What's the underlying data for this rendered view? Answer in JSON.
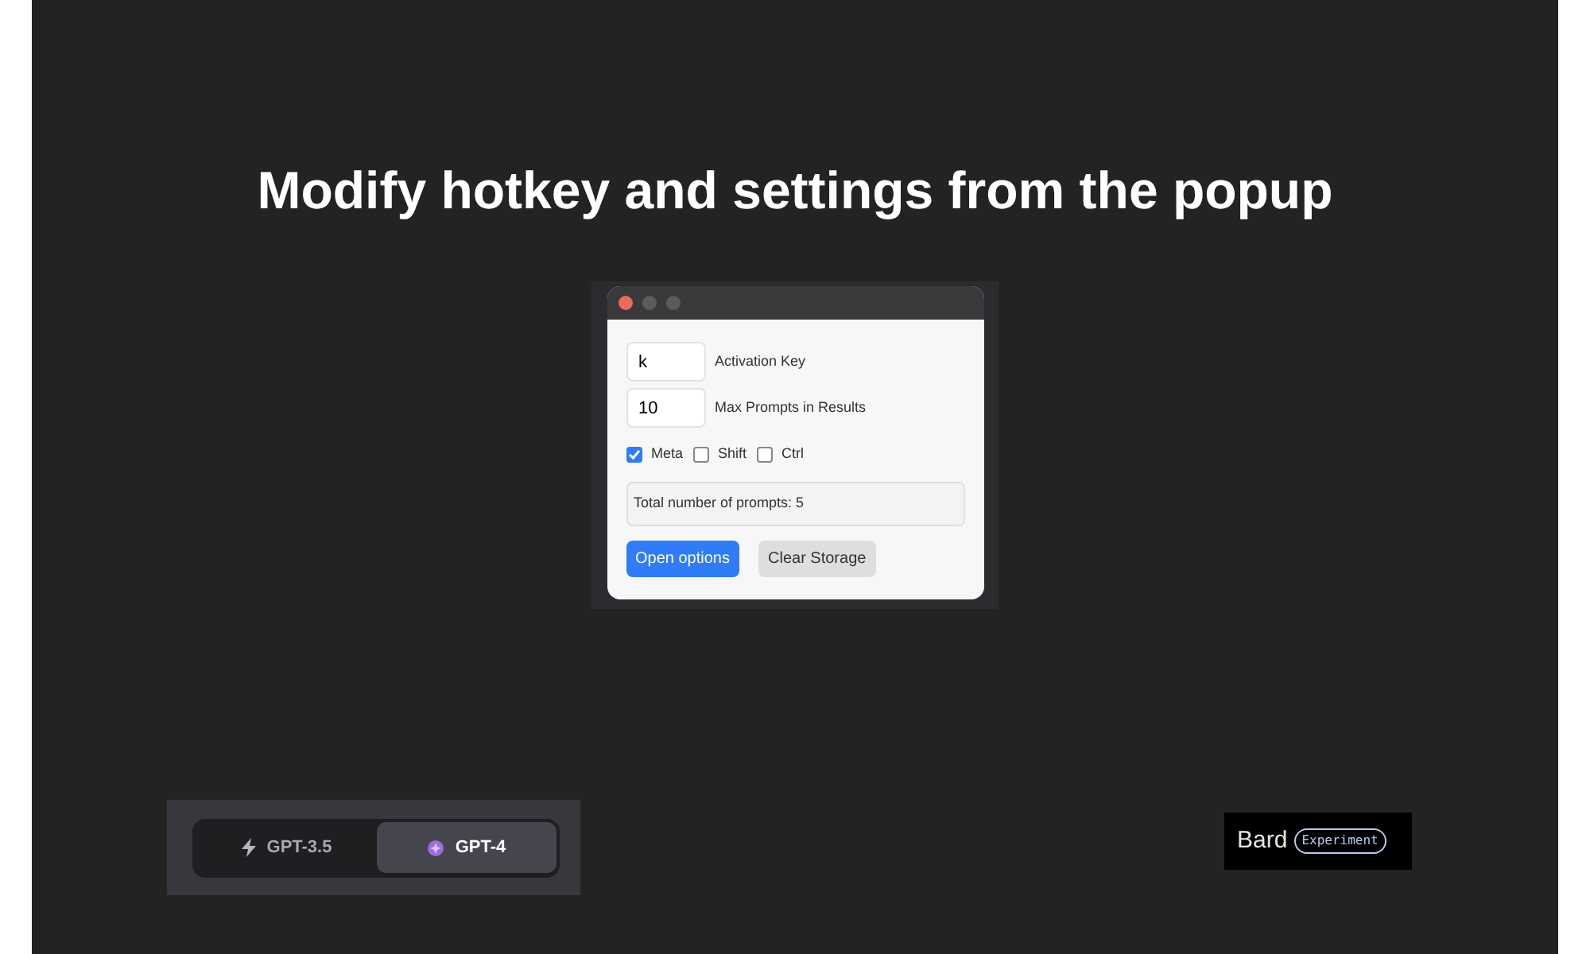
{
  "headline": "Modify hotkey and settings from the popup",
  "popup": {
    "fields": [
      {
        "value": "k",
        "label": "Activation Key"
      },
      {
        "value": "10",
        "label": "Max Prompts in Results"
      }
    ],
    "modifiers": [
      {
        "label": "Meta",
        "checked": true
      },
      {
        "label": "Shift",
        "checked": false
      },
      {
        "label": "Ctrl",
        "checked": false
      }
    ],
    "total": "Total number of prompts: 5",
    "buttons": [
      {
        "label": "Open options",
        "kind": "primary"
      },
      {
        "label": "Clear Storage",
        "kind": "secondary"
      }
    ]
  },
  "model_switch": [
    {
      "label": "GPT-3.5",
      "kind": "bolt",
      "selected": false
    },
    {
      "label": "GPT-4",
      "kind": "sparkle",
      "selected": true
    }
  ],
  "badge": {
    "name": "Bard",
    "tag": "Experiment"
  }
}
